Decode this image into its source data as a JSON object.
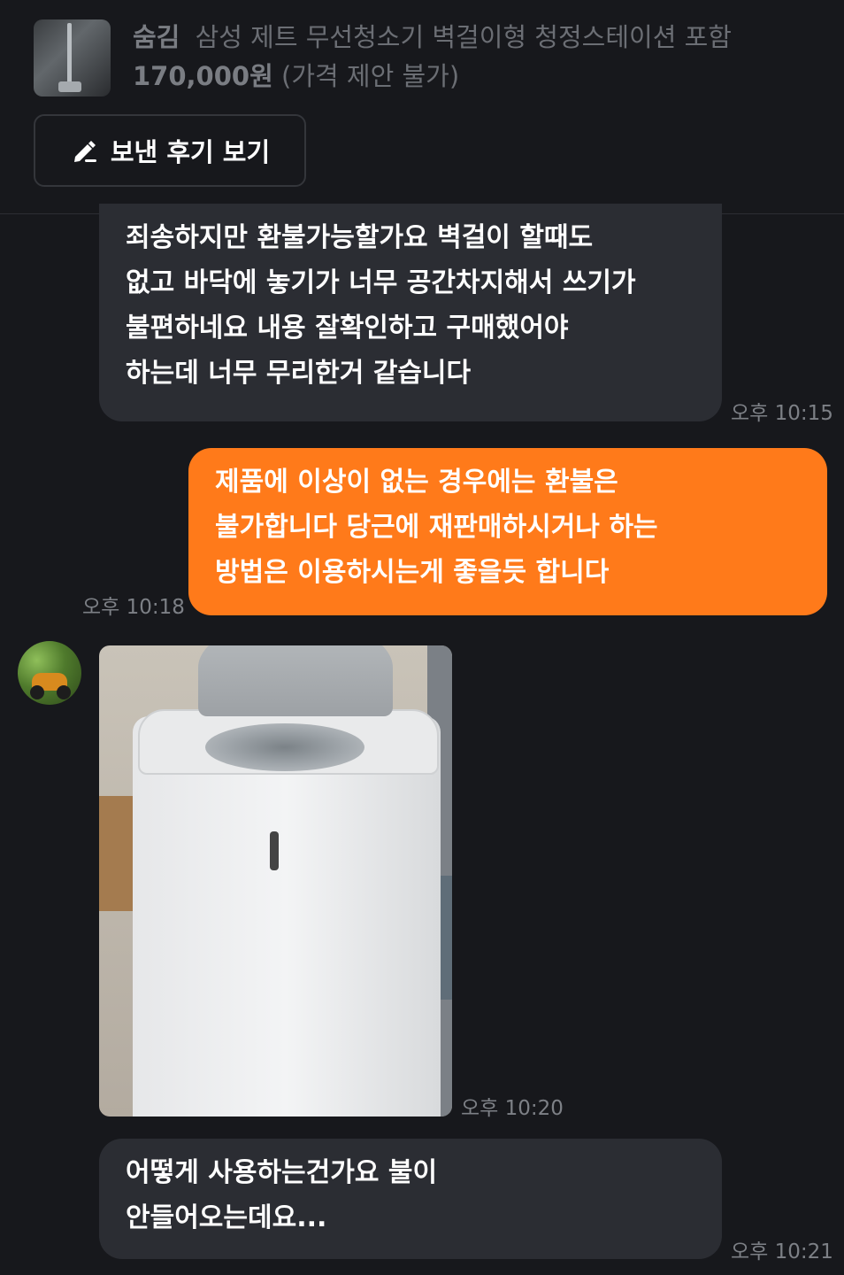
{
  "product": {
    "status": "숨김",
    "title": "삼성 제트 무선청소기 벽걸이형 청정스테이션 포함",
    "price": "170,000원",
    "price_note": "(가격 제안 불가)",
    "thumbnail_icon": "vacuum-thumbnail"
  },
  "review_button": {
    "label": "보낸 후기 보기",
    "icon": "pencil-icon"
  },
  "messages": [
    {
      "direction": "in",
      "lines": [
        "죄송하지만 환불가능할가요 벽걸이 할때도",
        "없고 바닥에 놓기가 너무 공간차지해서 쓰기가",
        "불편하네요 내용 잘확인하고 구매했어야",
        "하는데 너무 무리한거 같습니다"
      ],
      "time": "오후 10:15"
    },
    {
      "direction": "out",
      "lines": [
        "제품에 이상이 없는 경우에는 환불은",
        "불가합니다 당근에 재판매하시거나 하는",
        "방법은 이용하시는게 좋을듯 합니다"
      ],
      "time": "오후 10:18"
    },
    {
      "direction": "in",
      "type": "image",
      "time": "오후 10:20"
    },
    {
      "direction": "in",
      "lines": [
        "어떻게 사용하는건가요 불이",
        "안들어오는데요..."
      ],
      "time": "오후 10:21"
    }
  ],
  "colors": {
    "background": "#17181c",
    "incoming_bubble": "#2b2d33",
    "outgoing_bubble": "#ff7a1a",
    "muted_text": "#6b6e74"
  }
}
